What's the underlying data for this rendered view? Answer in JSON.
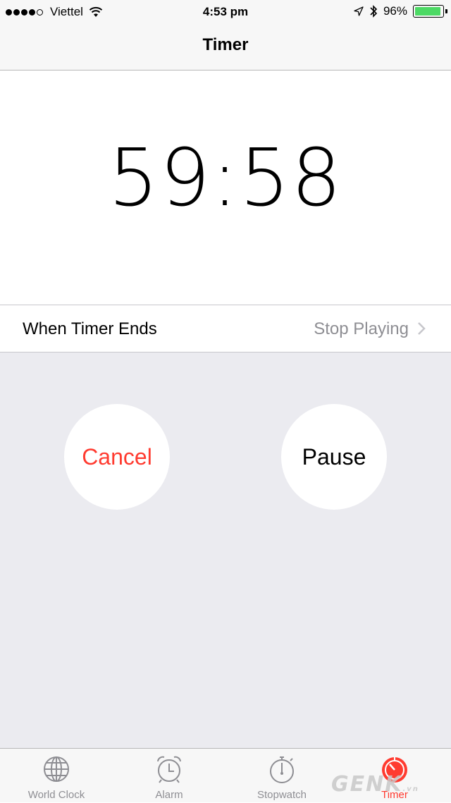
{
  "status_bar": {
    "carrier": "Viettel",
    "time": "4:53 pm",
    "battery_percent": "96%",
    "signal_bars_filled": 4,
    "signal_bars_total": 5,
    "battery_level": 0.96,
    "icons": [
      "wifi-icon",
      "location-icon",
      "bluetooth-icon",
      "battery-icon"
    ]
  },
  "nav": {
    "title": "Timer"
  },
  "timer": {
    "minutes": "59",
    "separator": ":",
    "seconds": "58"
  },
  "settings_row": {
    "label": "When Timer Ends",
    "value": "Stop Playing"
  },
  "buttons": {
    "cancel": "Cancel",
    "pause": "Pause"
  },
  "tabs": [
    {
      "label": "World Clock",
      "icon": "globe-icon"
    },
    {
      "label": "Alarm",
      "icon": "alarm-clock-icon"
    },
    {
      "label": "Stopwatch",
      "icon": "stopwatch-icon"
    },
    {
      "label": "Timer",
      "icon": "timer-icon",
      "active": true
    }
  ],
  "colors": {
    "accent": "#ff3b30",
    "secondary_text": "#8e8e93",
    "controls_background": "#ebebf0",
    "battery_green": "#4cd964"
  },
  "watermark": {
    "text": "GENK",
    "suffix": ".vn"
  }
}
